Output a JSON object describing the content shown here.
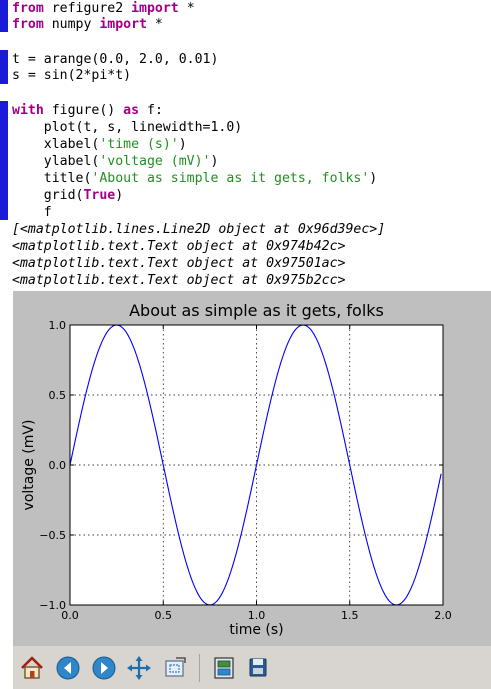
{
  "cells": [
    {
      "lines": [
        [
          {
            "t": "from",
            "c": "kw"
          },
          {
            "t": " refigure2 ",
            "c": ""
          },
          {
            "t": "import",
            "c": "kw"
          },
          {
            "t": " *",
            "c": ""
          }
        ],
        [
          {
            "t": "from",
            "c": "kw"
          },
          {
            "t": " numpy ",
            "c": ""
          },
          {
            "t": "import",
            "c": "kw"
          },
          {
            "t": " *",
            "c": ""
          }
        ]
      ]
    },
    {
      "lines": [
        [
          {
            "t": "t = arange(0.0, 2.0, 0.01)",
            "c": ""
          }
        ],
        [
          {
            "t": "s = sin(2*pi*t)",
            "c": ""
          }
        ]
      ]
    },
    {
      "lines": [
        [
          {
            "t": "with",
            "c": "kw"
          },
          {
            "t": " figure() ",
            "c": ""
          },
          {
            "t": "as",
            "c": "kw"
          },
          {
            "t": " f:",
            "c": ""
          }
        ],
        [
          {
            "t": "    plot(t, s, linewidth=1.0)",
            "c": ""
          }
        ],
        [
          {
            "t": "    xlabel(",
            "c": ""
          },
          {
            "t": "'time (s)'",
            "c": "str"
          },
          {
            "t": ")",
            "c": ""
          }
        ],
        [
          {
            "t": "    ylabel(",
            "c": ""
          },
          {
            "t": "'voltage (mV)'",
            "c": "str"
          },
          {
            "t": ")",
            "c": ""
          }
        ],
        [
          {
            "t": "    title(",
            "c": ""
          },
          {
            "t": "'About as simple as it gets, folks'",
            "c": "str"
          },
          {
            "t": ")",
            "c": ""
          }
        ],
        [
          {
            "t": "    grid(",
            "c": ""
          },
          {
            "t": "True",
            "c": "kw"
          },
          {
            "t": ")",
            "c": ""
          }
        ],
        [
          {
            "t": "    f",
            "c": ""
          }
        ]
      ]
    }
  ],
  "output_lines": [
    "[<matplotlib.lines.Line2D object at 0x96d39ec>]",
    "<matplotlib.text.Text object at 0x974b42c>",
    "<matplotlib.text.Text object at 0x97501ac>",
    "<matplotlib.text.Text object at 0x975b2cc>"
  ],
  "chart_data": {
    "type": "line",
    "title": "About as simple as it gets, folks",
    "xlabel": "time (s)",
    "ylabel": "voltage (mV)",
    "xlim": [
      0.0,
      2.0
    ],
    "ylim": [
      -1.0,
      1.0
    ],
    "xticks": [
      0.0,
      0.5,
      1.0,
      1.5,
      2.0
    ],
    "xtick_labels": [
      "0.0",
      "0.5",
      "1.0",
      "1.5",
      "2.0"
    ],
    "yticks": [
      1.0,
      0.5,
      0.0,
      -0.5,
      -1.0
    ],
    "ytick_labels": [
      "1.0",
      "0.5",
      "0.0",
      "−0.5",
      "−1.0"
    ],
    "grid": true,
    "series": [
      {
        "function": "sin(2*pi*t)",
        "x_start": 0.0,
        "x_stop": 2.0,
        "x_step": 0.01,
        "color": "#0000ff",
        "linewidth": 1.0
      }
    ]
  },
  "toolbar": {
    "buttons": [
      {
        "name": "home-button",
        "icon": "home-icon"
      },
      {
        "name": "back-button",
        "icon": "back-arrow-icon"
      },
      {
        "name": "forward-button",
        "icon": "forward-arrow-icon"
      },
      {
        "name": "pan-button",
        "icon": "pan-icon"
      },
      {
        "name": "zoom-button",
        "icon": "zoom-rect-icon"
      },
      {
        "name": "subplots-button",
        "icon": "subplots-icon"
      },
      {
        "name": "save-button",
        "icon": "save-icon"
      }
    ]
  }
}
